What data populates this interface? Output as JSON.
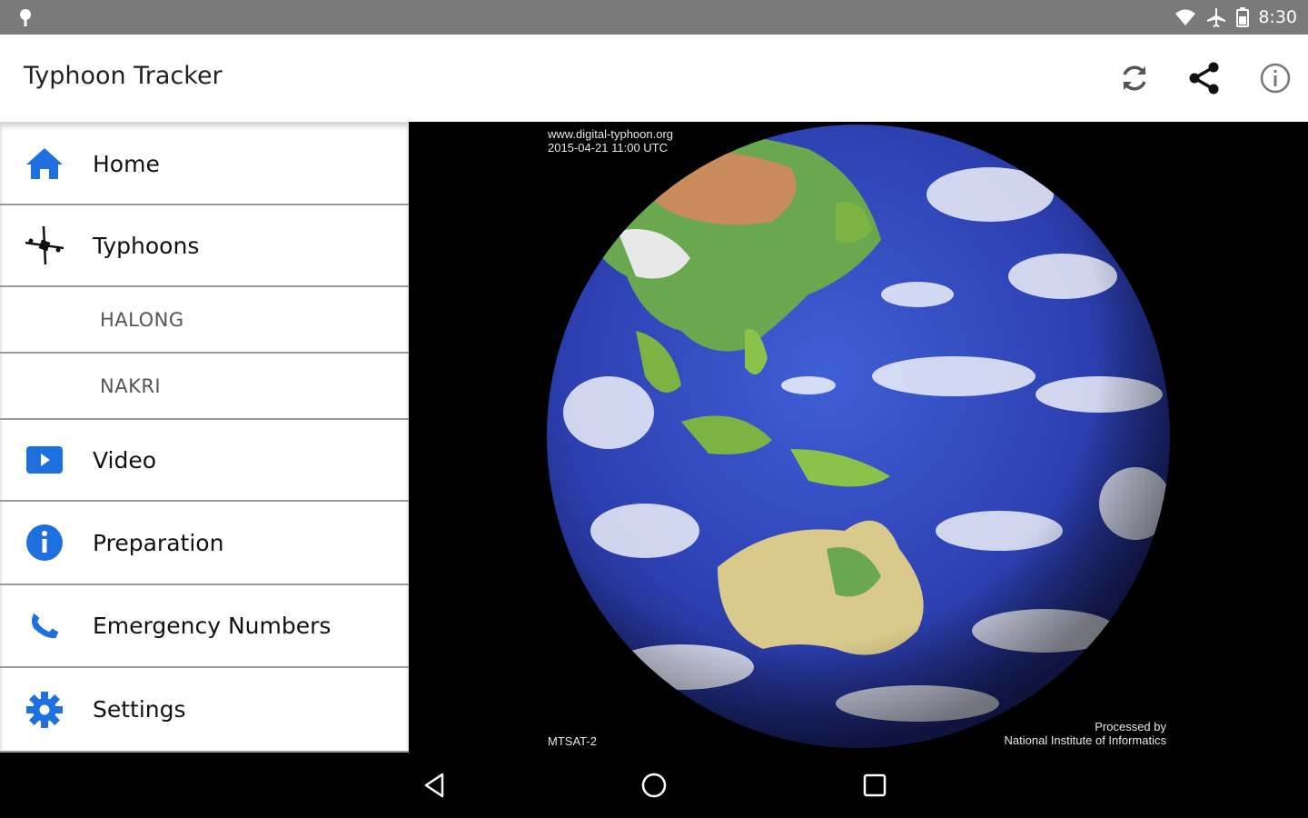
{
  "status_bar": {
    "time": "8:30",
    "icons": [
      "location-pin-icon",
      "wifi-icon",
      "airplane-mode-icon",
      "battery-icon"
    ]
  },
  "app_bar": {
    "title": "Typhoon Tracker",
    "actions": [
      "refresh-icon",
      "share-icon",
      "info-icon"
    ]
  },
  "drawer": {
    "items": [
      {
        "label": "Home",
        "icon": "home-icon",
        "color": "#1e6fe0"
      },
      {
        "label": "Typhoons",
        "icon": "typhoon-satellite-icon",
        "color": "#111111"
      },
      {
        "label": "HALONG"
      },
      {
        "label": "NAKRI"
      },
      {
        "label": "Video",
        "icon": "video-play-icon",
        "color": "#1e6fe0"
      },
      {
        "label": "Preparation",
        "icon": "info-circle-icon",
        "color": "#1e6fe0"
      },
      {
        "label": "Emergency Numbers",
        "icon": "phone-icon",
        "color": "#1e6fe0"
      },
      {
        "label": "Settings",
        "icon": "gear-icon",
        "color": "#1e6fe0"
      }
    ]
  },
  "map": {
    "source_line1": "www.digital-typhoon.org",
    "source_line2": "2015-04-21 11:00 UTC",
    "satellite": "MTSAT-2",
    "credit_line1": "Processed by",
    "credit_line2": "National Institute of Informatics"
  },
  "nav_bar": {
    "buttons": [
      "back-icon",
      "home-circle-icon",
      "recents-icon"
    ]
  }
}
